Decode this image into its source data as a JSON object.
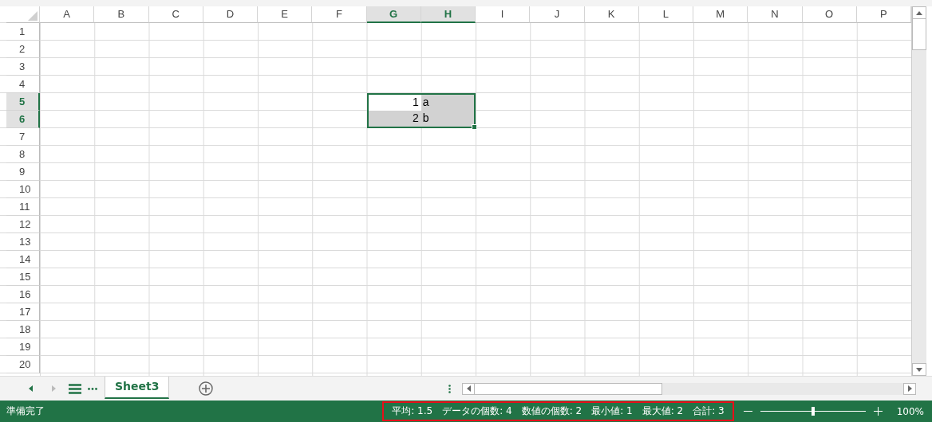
{
  "columns": [
    {
      "label": "A",
      "selected": false
    },
    {
      "label": "B",
      "selected": false
    },
    {
      "label": "C",
      "selected": false
    },
    {
      "label": "D",
      "selected": false
    },
    {
      "label": "E",
      "selected": false
    },
    {
      "label": "F",
      "selected": false
    },
    {
      "label": "G",
      "selected": true
    },
    {
      "label": "H",
      "selected": true
    },
    {
      "label": "I",
      "selected": false
    },
    {
      "label": "J",
      "selected": false
    },
    {
      "label": "K",
      "selected": false
    },
    {
      "label": "L",
      "selected": false
    },
    {
      "label": "M",
      "selected": false
    },
    {
      "label": "N",
      "selected": false
    },
    {
      "label": "O",
      "selected": false
    },
    {
      "label": "P",
      "selected": false
    }
  ],
  "rows": [
    {
      "label": "1",
      "selected": false
    },
    {
      "label": "2",
      "selected": false
    },
    {
      "label": "3",
      "selected": false
    },
    {
      "label": "4",
      "selected": false
    },
    {
      "label": "5",
      "selected": true,
      "cells": [
        null,
        null,
        null,
        null,
        null,
        null,
        {
          "value": "1",
          "kind": "number",
          "selected": true,
          "active": true
        },
        {
          "value": "a",
          "kind": "text",
          "selected": true,
          "active": false
        },
        null,
        null,
        null,
        null,
        null,
        null,
        null,
        null
      ]
    },
    {
      "label": "6",
      "selected": true,
      "cells": [
        null,
        null,
        null,
        null,
        null,
        null,
        {
          "value": "2",
          "kind": "number",
          "selected": true,
          "active": false
        },
        {
          "value": "b",
          "kind": "text",
          "selected": true,
          "active": false
        },
        null,
        null,
        null,
        null,
        null,
        null,
        null,
        null
      ]
    },
    {
      "label": "7",
      "selected": false
    },
    {
      "label": "8",
      "selected": false
    },
    {
      "label": "9",
      "selected": false
    },
    {
      "label": "10",
      "selected": false
    },
    {
      "label": "11",
      "selected": false
    },
    {
      "label": "12",
      "selected": false
    },
    {
      "label": "13",
      "selected": false
    },
    {
      "label": "14",
      "selected": false
    },
    {
      "label": "15",
      "selected": false
    },
    {
      "label": "16",
      "selected": false
    },
    {
      "label": "17",
      "selected": false
    },
    {
      "label": "18",
      "selected": false
    },
    {
      "label": "19",
      "selected": false
    },
    {
      "label": "20",
      "selected": false
    }
  ],
  "sheet_tabs": [
    {
      "label": "Sheet3",
      "selected": true
    }
  ],
  "status_bar": {
    "status": "準備完了",
    "stats": [
      "平均: 1.5",
      "データの個数: 4",
      "数値の個数: 2",
      "最小値: 1",
      "最大値: 2",
      "合計: 3"
    ],
    "zoom": {
      "level": 0.5,
      "reading": "100%"
    }
  }
}
